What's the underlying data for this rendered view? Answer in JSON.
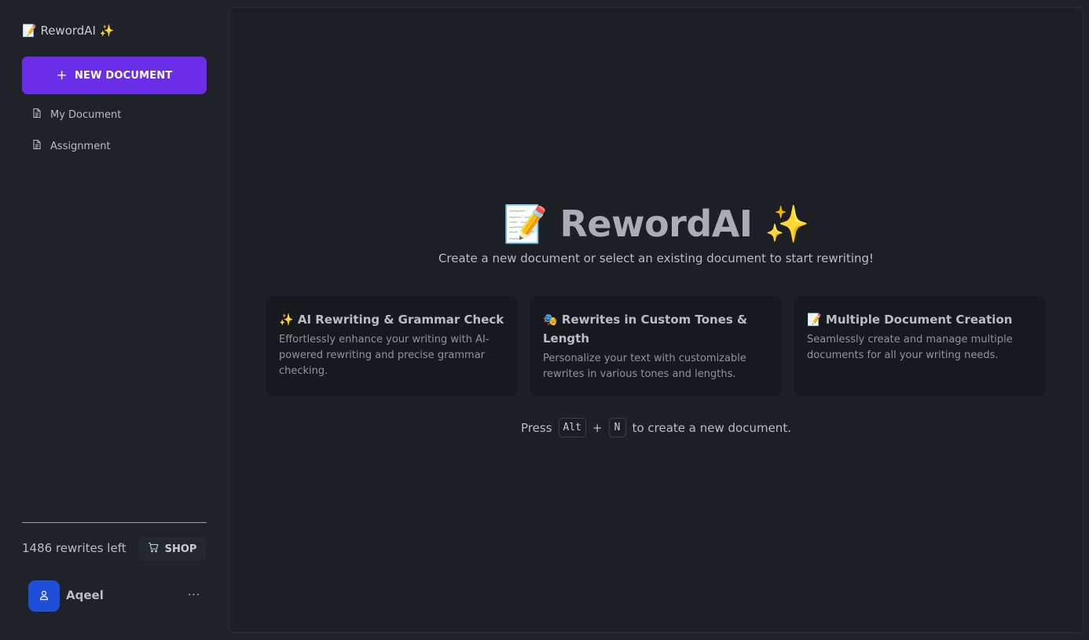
{
  "sidebar": {
    "brand": "📝 RewordAI ✨",
    "new_document_label": "NEW DOCUMENT",
    "documents": [
      {
        "label": "My Document"
      },
      {
        "label": "Assignment"
      }
    ],
    "rewrites_left": "1486 rewrites left",
    "shop_label": "SHOP",
    "user": {
      "name": "Aqeel",
      "more": "···"
    }
  },
  "main": {
    "title": "📝 RewordAI ✨",
    "subtitle": "Create a new document or select an existing document to start rewriting!",
    "features": [
      {
        "title": "✨ AI Rewriting & Grammar Check",
        "description": "Effortlessly enhance your writing with AI-powered rewriting and precise grammar checking."
      },
      {
        "title": "🎭 Rewrites in Custom Tones & Length",
        "description": "Personalize your text with customizable rewrites in various tones and lengths."
      },
      {
        "title": "📝 Multiple Document Creation",
        "description": "Seamlessly create and manage multiple documents for all your writing needs."
      }
    ],
    "shortcut": {
      "prefix": "Press",
      "key1": "Alt",
      "plus": "+",
      "key2": "N",
      "suffix": "to create a new document."
    }
  },
  "colors": {
    "accent": "#6b2ee8",
    "avatar": "#1d4fd8",
    "background": "#1f2329",
    "panel": "#1c1f24",
    "card": "#16191d"
  },
  "icons": [
    "plus-icon",
    "document-icon",
    "cart-icon",
    "user-icon",
    "more-icon"
  ]
}
